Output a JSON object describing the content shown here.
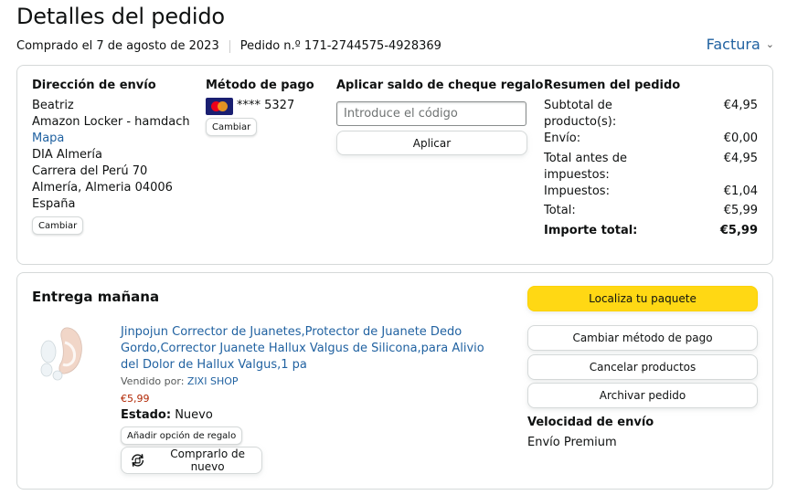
{
  "header": {
    "title": "Detalles del pedido",
    "purchased": "Comprado el 7 de agosto de 2023",
    "order_number": "Pedido n.º 171-2744575-4928369",
    "invoice_label": "Factura"
  },
  "shipping": {
    "title": "Dirección de envío",
    "name": "Beatriz",
    "locker": "Amazon Locker - hamdach",
    "map_link": "Mapa",
    "line1": "DIA Almería",
    "line2": "Carrera del Perú 70",
    "line3": "Almería, Almeria 04006",
    "country": "España",
    "change_label": "Cambiar"
  },
  "payment": {
    "title": "Método de pago",
    "card_icon": "mastercard-icon",
    "card_number": "**** 5327",
    "change_label": "Cambiar"
  },
  "gift": {
    "title": "Aplicar saldo de cheque regalo",
    "placeholder": "Introduce el código",
    "apply_label": "Aplicar"
  },
  "summary": {
    "title": "Resumen del pedido",
    "rows": [
      {
        "label": "Subtotal de producto(s):",
        "value": "€4,95"
      },
      {
        "label": "Envío:",
        "value": "€0,00"
      },
      {
        "label": "Total antes de impuestos:",
        "value": "€4,95"
      },
      {
        "label": "Impuestos:",
        "value": "€1,04"
      },
      {
        "label": "Total:",
        "value": "€5,99"
      }
    ],
    "grand_label": "Importe total:",
    "grand_value": "€5,99"
  },
  "delivery": {
    "title": "Entrega mañana",
    "product_title": "Jinpojun Corrector de Juanetes,Protector de Juanete Dedo Gordo,Corrector Juanete Hallux Valgus de Silicona,para Alivio del Dolor de Hallux Valgus,1 pa",
    "sold_by_label": "Vendido por:",
    "seller": "ZIXI SHOP",
    "price": "€5,99",
    "state_label": "Estado:",
    "state_value": "Nuevo",
    "gift_option": "Añadir opción de regalo",
    "rebuy": "Comprarlo de nuevo",
    "actions": {
      "track": "Localiza tu paquete",
      "change_payment": "Cambiar método de pago",
      "cancel": "Cancelar productos",
      "archive": "Archivar pedido"
    },
    "speed_title": "Velocidad de envío",
    "speed_value": "Envío Premium"
  },
  "colors": {
    "link": "#2162A1",
    "accent_yellow": "#FFD814",
    "price_red": "#B12704"
  }
}
